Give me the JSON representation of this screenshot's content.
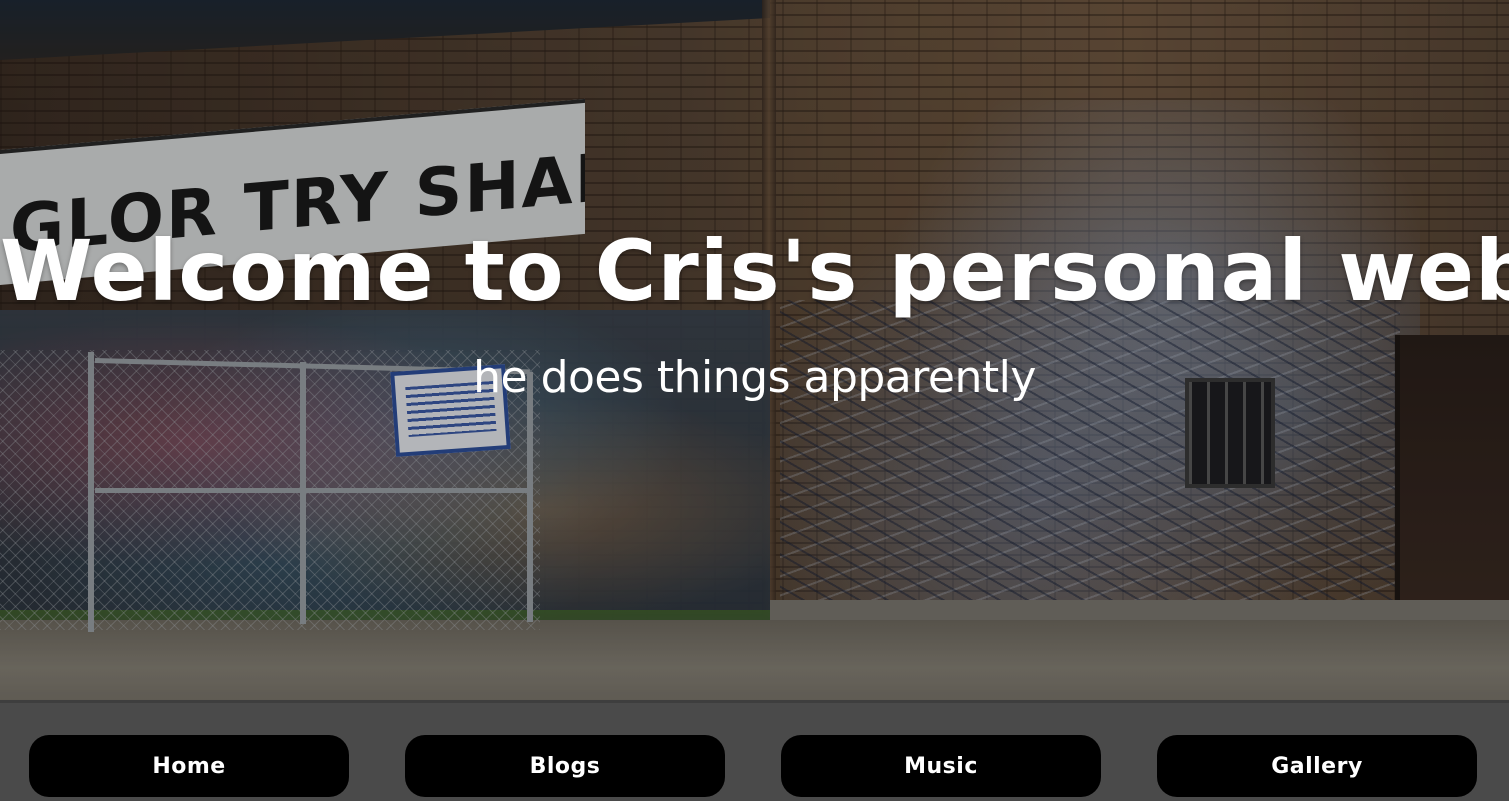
{
  "hero": {
    "title": "Welcome to Cris's personal website >:D",
    "subtitle": "he does things apparently",
    "banner_text": "GLOR TRY SHARING"
  },
  "nav": {
    "items": [
      {
        "label": "Home"
      },
      {
        "label": "Blogs"
      },
      {
        "label": "Music"
      },
      {
        "label": "Gallery"
      }
    ]
  },
  "colors": {
    "nav_background": "#4a4a4a",
    "button_background": "#000000",
    "text": "#ffffff"
  }
}
